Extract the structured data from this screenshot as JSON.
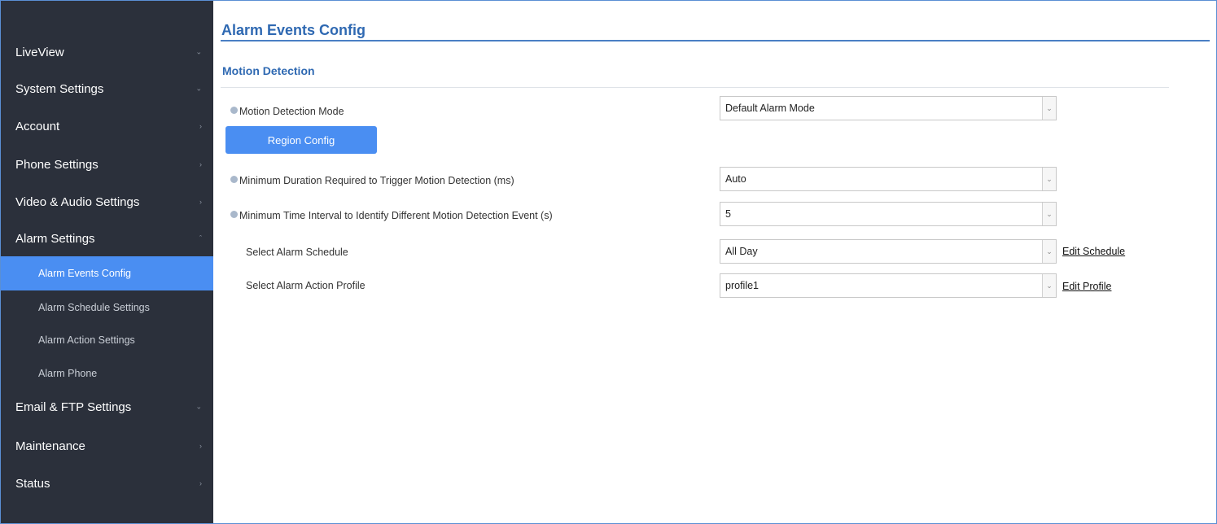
{
  "sidebar": {
    "items": [
      {
        "label": "LiveView",
        "chevron": "chevron-down"
      },
      {
        "label": "System Settings",
        "chevron": "chevron-down"
      },
      {
        "label": "Account",
        "chevron": "chevron-right"
      },
      {
        "label": "Phone Settings",
        "chevron": "chevron-right"
      },
      {
        "label": "Video & Audio Settings",
        "chevron": "chevron-right"
      },
      {
        "label": "Alarm Settings",
        "chevron": "chevron-up"
      },
      {
        "label": "Email & FTP Settings",
        "chevron": "chevron-down"
      },
      {
        "label": "Maintenance",
        "chevron": "chevron-right"
      },
      {
        "label": "Status",
        "chevron": "chevron-right"
      }
    ],
    "alarm_sub_items": [
      {
        "label": "Alarm Events Config",
        "active": true
      },
      {
        "label": "Alarm Schedule Settings",
        "active": false
      },
      {
        "label": "Alarm Action Settings",
        "active": false
      },
      {
        "label": "Alarm Phone",
        "active": false
      }
    ]
  },
  "main": {
    "title": "Alarm Events Config",
    "section_title": "Motion Detection",
    "fields": {
      "mode": {
        "label": "Motion Detection Mode",
        "value": "Default Alarm Mode"
      },
      "region_button": "Region Config",
      "min_duration": {
        "label": "Minimum Duration Required to Trigger Motion Detection (ms)",
        "value": "Auto"
      },
      "min_interval": {
        "label": "Minimum Time Interval to Identify Different Motion Detection Event (s)",
        "value": "5"
      },
      "schedule": {
        "label": "Select Alarm Schedule",
        "value": "All Day",
        "link": "Edit Schedule"
      },
      "action_profile": {
        "label": "Select Alarm Action Profile",
        "value": "profile1",
        "link": "Edit Profile"
      }
    }
  },
  "colors": {
    "sidebar_bg": "#2b303b",
    "accent": "#4a8ef2",
    "title": "#2f69b2"
  }
}
